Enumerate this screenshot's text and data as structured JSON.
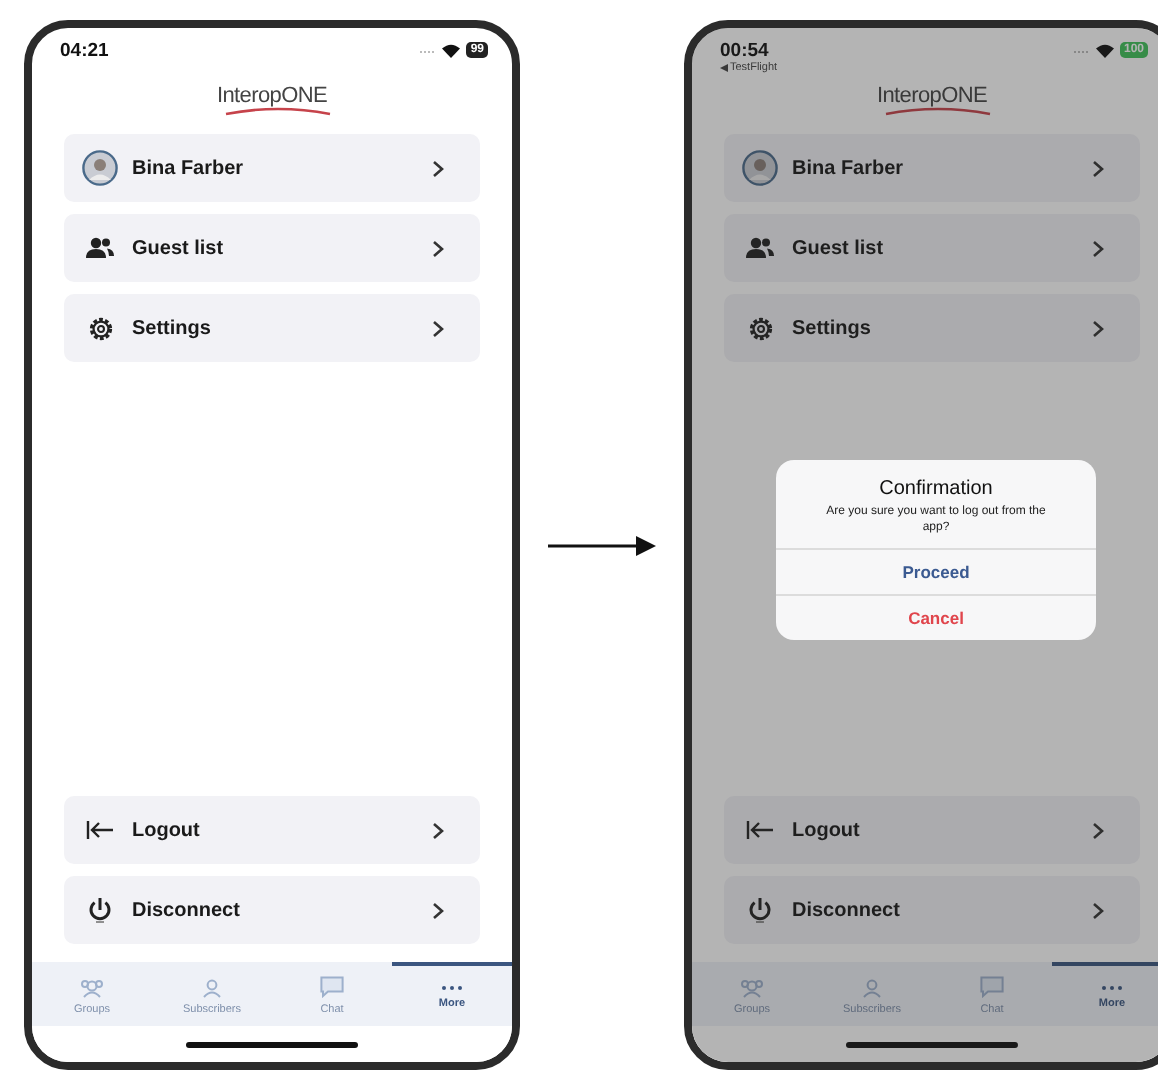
{
  "screens": [
    {
      "status_bar": {
        "time": "04:21",
        "battery": "99",
        "charging": false
      },
      "logo": "InteropONE",
      "dimmed": false,
      "menu_top": [
        {
          "kind": "avatar",
          "label": "Bina Farber"
        },
        {
          "kind": "people",
          "label": "Guest list"
        },
        {
          "kind": "gear",
          "label": "Settings"
        }
      ],
      "menu_bottom": [
        {
          "kind": "logout",
          "label": "Logout"
        },
        {
          "kind": "power",
          "label": "Disconnect"
        }
      ],
      "tabs": [
        {
          "kind": "groups",
          "label": "Groups",
          "selected": false
        },
        {
          "kind": "person",
          "label": "Subscribers",
          "selected": false
        },
        {
          "kind": "chat",
          "label": "Chat",
          "selected": false
        },
        {
          "kind": "more",
          "label": "More",
          "selected": true
        }
      ]
    },
    {
      "status_bar": {
        "time": "00:54",
        "battery": "100",
        "charging": true
      },
      "back_link": "TestFlight",
      "logo": "InteropONE",
      "dimmed": true,
      "menu_top": [
        {
          "kind": "avatar",
          "label": "Bina Farber"
        },
        {
          "kind": "people",
          "label": "Guest list"
        },
        {
          "kind": "gear",
          "label": "Settings"
        }
      ],
      "menu_bottom": [
        {
          "kind": "logout",
          "label": "Logout"
        },
        {
          "kind": "power",
          "label": "Disconnect"
        }
      ],
      "tabs": [
        {
          "kind": "groups",
          "label": "Groups",
          "selected": false
        },
        {
          "kind": "person",
          "label": "Subscribers",
          "selected": false
        },
        {
          "kind": "chat",
          "label": "Chat",
          "selected": false
        },
        {
          "kind": "more",
          "label": "More",
          "selected": true
        }
      ],
      "dialog": {
        "title": "Confirmation",
        "message": "Are you sure you want to log out from the app?",
        "buttons": [
          {
            "kind": "primary",
            "label": "Proceed"
          },
          {
            "kind": "destructive",
            "label": "Cancel"
          }
        ]
      }
    }
  ]
}
